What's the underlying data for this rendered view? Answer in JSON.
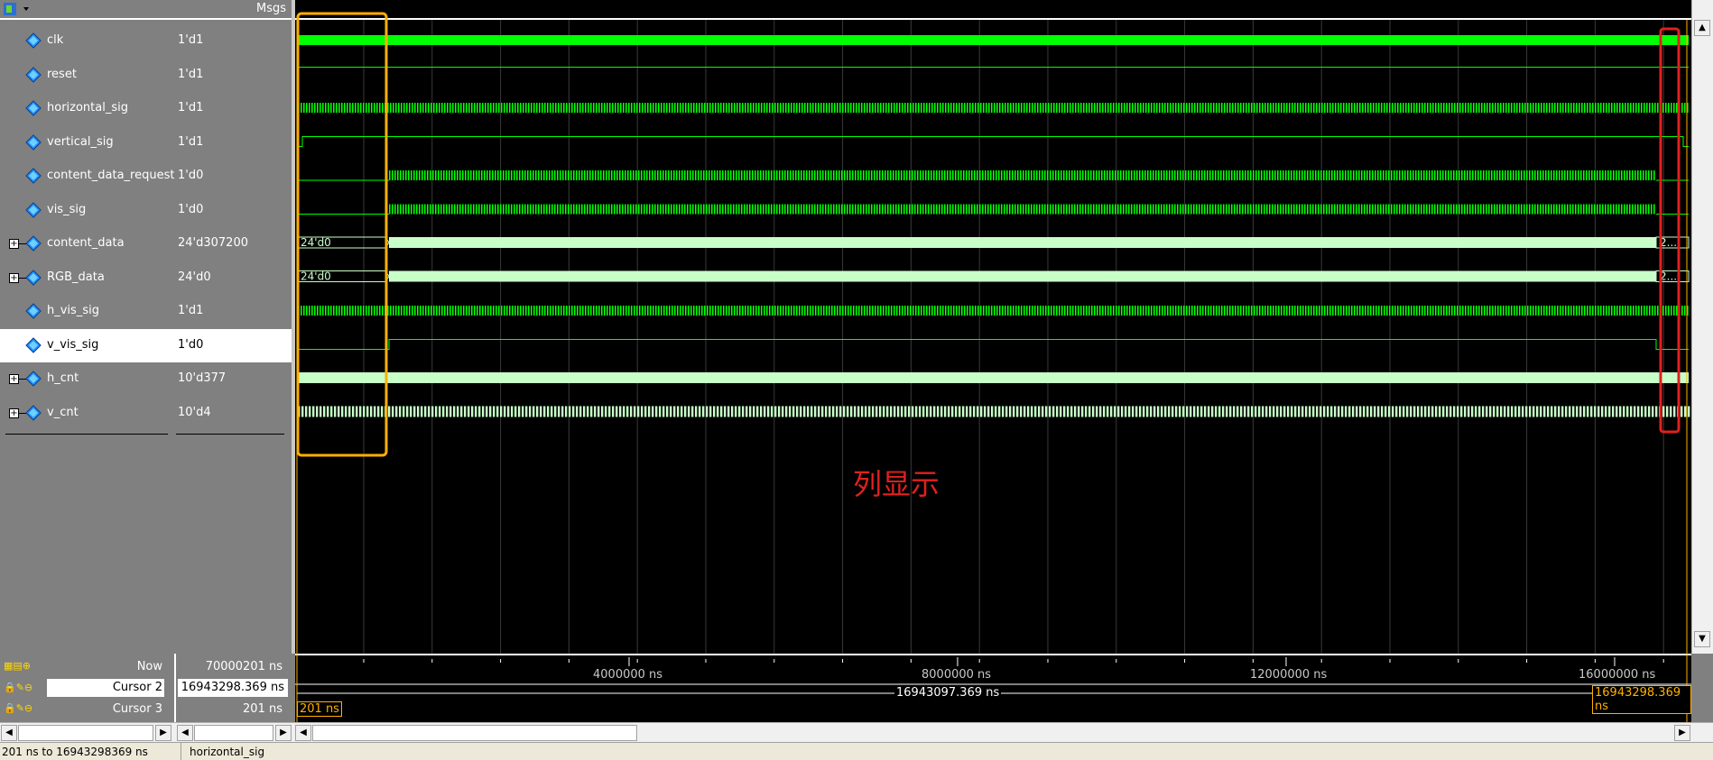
{
  "header": {
    "msgs_label": "Msgs"
  },
  "signals": [
    {
      "name": "clk",
      "value": "1'd1",
      "expandable": false,
      "icon": "signal-diamond-icon"
    },
    {
      "name": "reset",
      "value": "1'd1",
      "expandable": false,
      "icon": "signal-diamond-icon"
    },
    {
      "name": "horizontal_sig",
      "value": "1'd1",
      "expandable": false,
      "icon": "signal-diamond-icon"
    },
    {
      "name": "vertical_sig",
      "value": "1'd1",
      "expandable": false,
      "icon": "signal-diamond-icon"
    },
    {
      "name": "content_data_request",
      "value": "1'd0",
      "expandable": false,
      "icon": "signal-diamond-icon"
    },
    {
      "name": "vis_sig",
      "value": "1'd0",
      "expandable": false,
      "icon": "signal-diamond-icon"
    },
    {
      "name": "content_data",
      "value": "24'd307200",
      "expandable": true,
      "icon": "signal-diamond-icon"
    },
    {
      "name": "RGB_data",
      "value": "24'd0",
      "expandable": true,
      "icon": "signal-diamond-icon"
    },
    {
      "name": "h_vis_sig",
      "value": "1'd1",
      "expandable": false,
      "icon": "signal-diamond-icon"
    },
    {
      "name": "v_vis_sig",
      "value": "1'd0",
      "expandable": false,
      "icon": "signal-diamond-icon"
    },
    {
      "name": "h_cnt",
      "value": "10'd377",
      "expandable": true,
      "icon": "signal-diamond-icon"
    },
    {
      "name": "v_cnt",
      "value": "10'd4",
      "expandable": true,
      "icon": "signal-diamond-icon"
    }
  ],
  "bus_labels": {
    "content_data_start": "24'd0",
    "content_data_end": "2...",
    "rgb_data_start": "24'd0",
    "rgb_data_end": "2..."
  },
  "cursors": {
    "now": {
      "label": "Now",
      "value": "70000201 ns"
    },
    "cursor2": {
      "label": "Cursor 2",
      "value": "16943298.369 ns"
    },
    "cursor3": {
      "label": "Cursor 3",
      "value": "201 ns"
    }
  },
  "timeline": {
    "ticks": [
      "4000000 ns",
      "8000000 ns",
      "12000000 ns",
      "16000000 ns"
    ],
    "delta_label": "16943097.369 ns",
    "cursor2_label": "16943298.369 ns",
    "cursor3_label": "201 ns"
  },
  "annotation": "列显示",
  "status": {
    "range": "201 ns to 16943298369 ns",
    "signal": "horizontal_sig"
  },
  "colors": {
    "wave": "#00ff00",
    "bus": "#c8ffc8",
    "yellow_box": "#ffb000",
    "red_box": "#e02020",
    "grid": "#404040"
  }
}
